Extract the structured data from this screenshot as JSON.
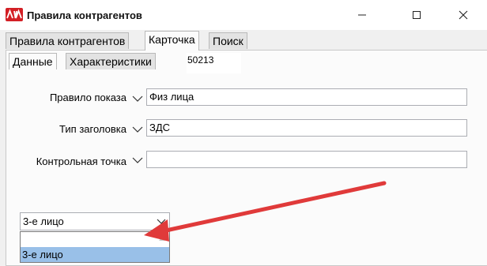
{
  "window": {
    "title": "Правила контрагентов"
  },
  "tabs": [
    {
      "label": "Правила контрагентов",
      "active": false
    },
    {
      "label": "Карточка",
      "active": true
    },
    {
      "label": "Поиск",
      "active": false
    }
  ],
  "subtabs": [
    {
      "label": "Данные",
      "active": true
    },
    {
      "label": "Характеристики",
      "active": false
    }
  ],
  "card_code": "50213",
  "form": {
    "display_rule": {
      "label": "Правило показа",
      "value": "Физ лица"
    },
    "header_type": {
      "label": "Тип заголовка",
      "value": "ЗДС"
    },
    "checkpoint": {
      "label": "Контрольная точка",
      "value": ""
    }
  },
  "party_combo": {
    "selected": "3-е лицо",
    "search_value": "",
    "options": [
      "3-е лицо"
    ]
  },
  "annotation_arrow_color": "#e03a3a",
  "accent_colors": {
    "icon": "#d31f25",
    "selection": "#99c0e8"
  }
}
